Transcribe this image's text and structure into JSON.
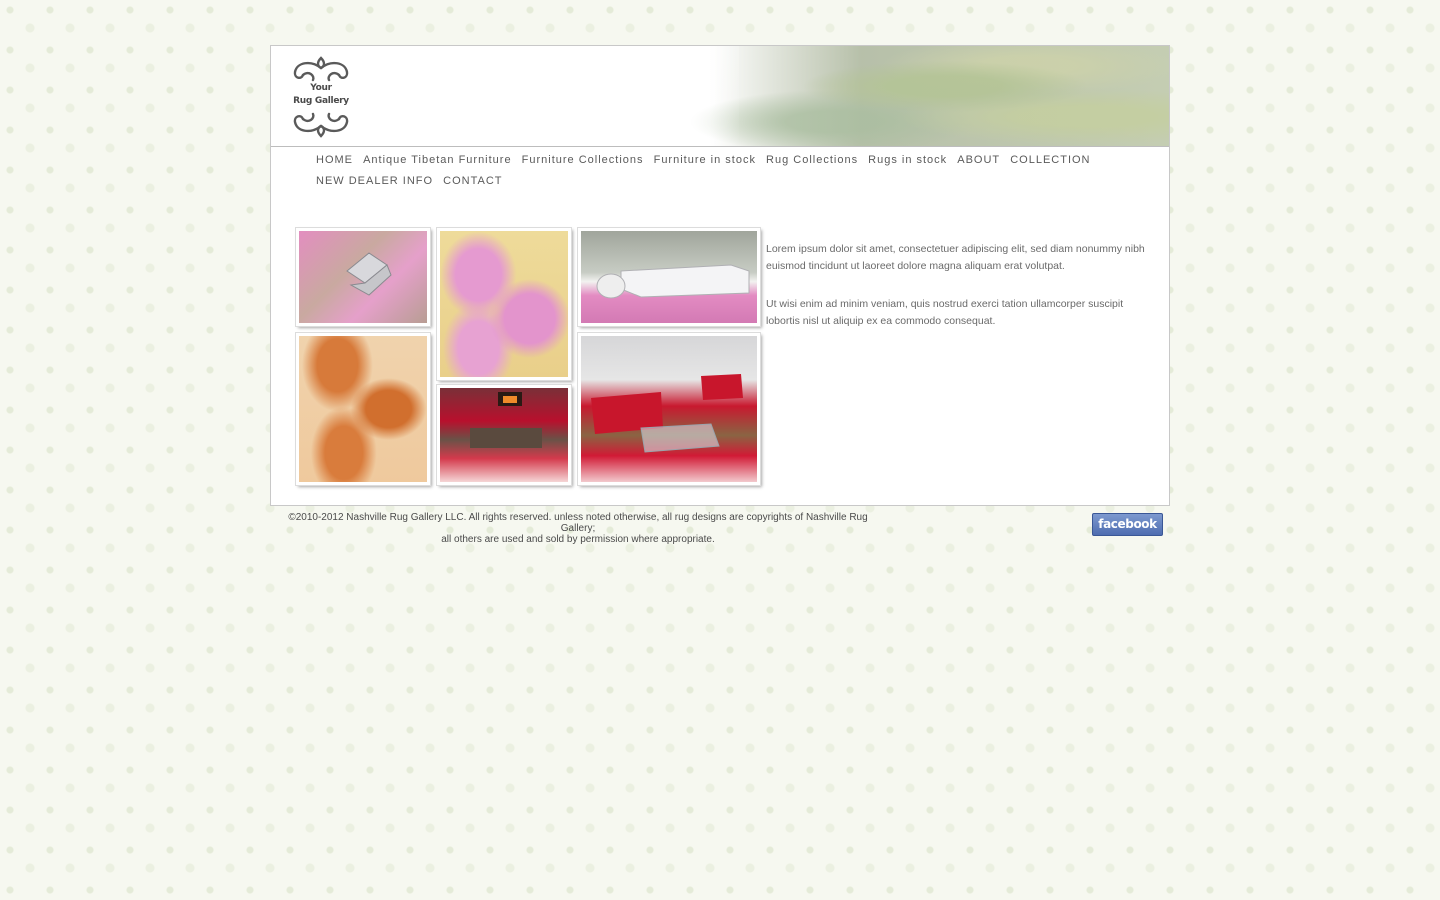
{
  "logo": {
    "line1": "Your",
    "line2": "Rug Gallery"
  },
  "nav": {
    "items": [
      "HOME",
      "Antique Tibetan Furniture",
      "Furniture Collections",
      "Furniture in stock",
      "Rug Collections",
      "Rugs in stock",
      "ABOUT",
      "COLLECTION",
      "NEW DEALER INFO",
      "CONTACT"
    ]
  },
  "intro": {
    "paragraph1": "Lorem ipsum dolor sit amet, consectetuer adipiscing elit, sed diam nonummy nibh euismod tincidunt ut laoreet dolore magna aliquam erat volutpat.",
    "paragraph2": "Ut wisi enim ad minim veniam, quis nostrud exerci tation ullamcorper suscipit lobortis nisl ut aliquip ex ea commodo consequat."
  },
  "footer": {
    "line1": "©2010-2012 Nashville Rug Gallery LLC. All rights reserved. unless noted otherwise, all rug designs are copyrights of Nashville Rug Gallery;",
    "line2": "all others are used and sold by permission where appropriate."
  },
  "facebook": {
    "label": "facebook"
  },
  "colors": {
    "text": "#5a5a5a",
    "facebook": "#4e6db0",
    "border": "#c8c8c8"
  }
}
